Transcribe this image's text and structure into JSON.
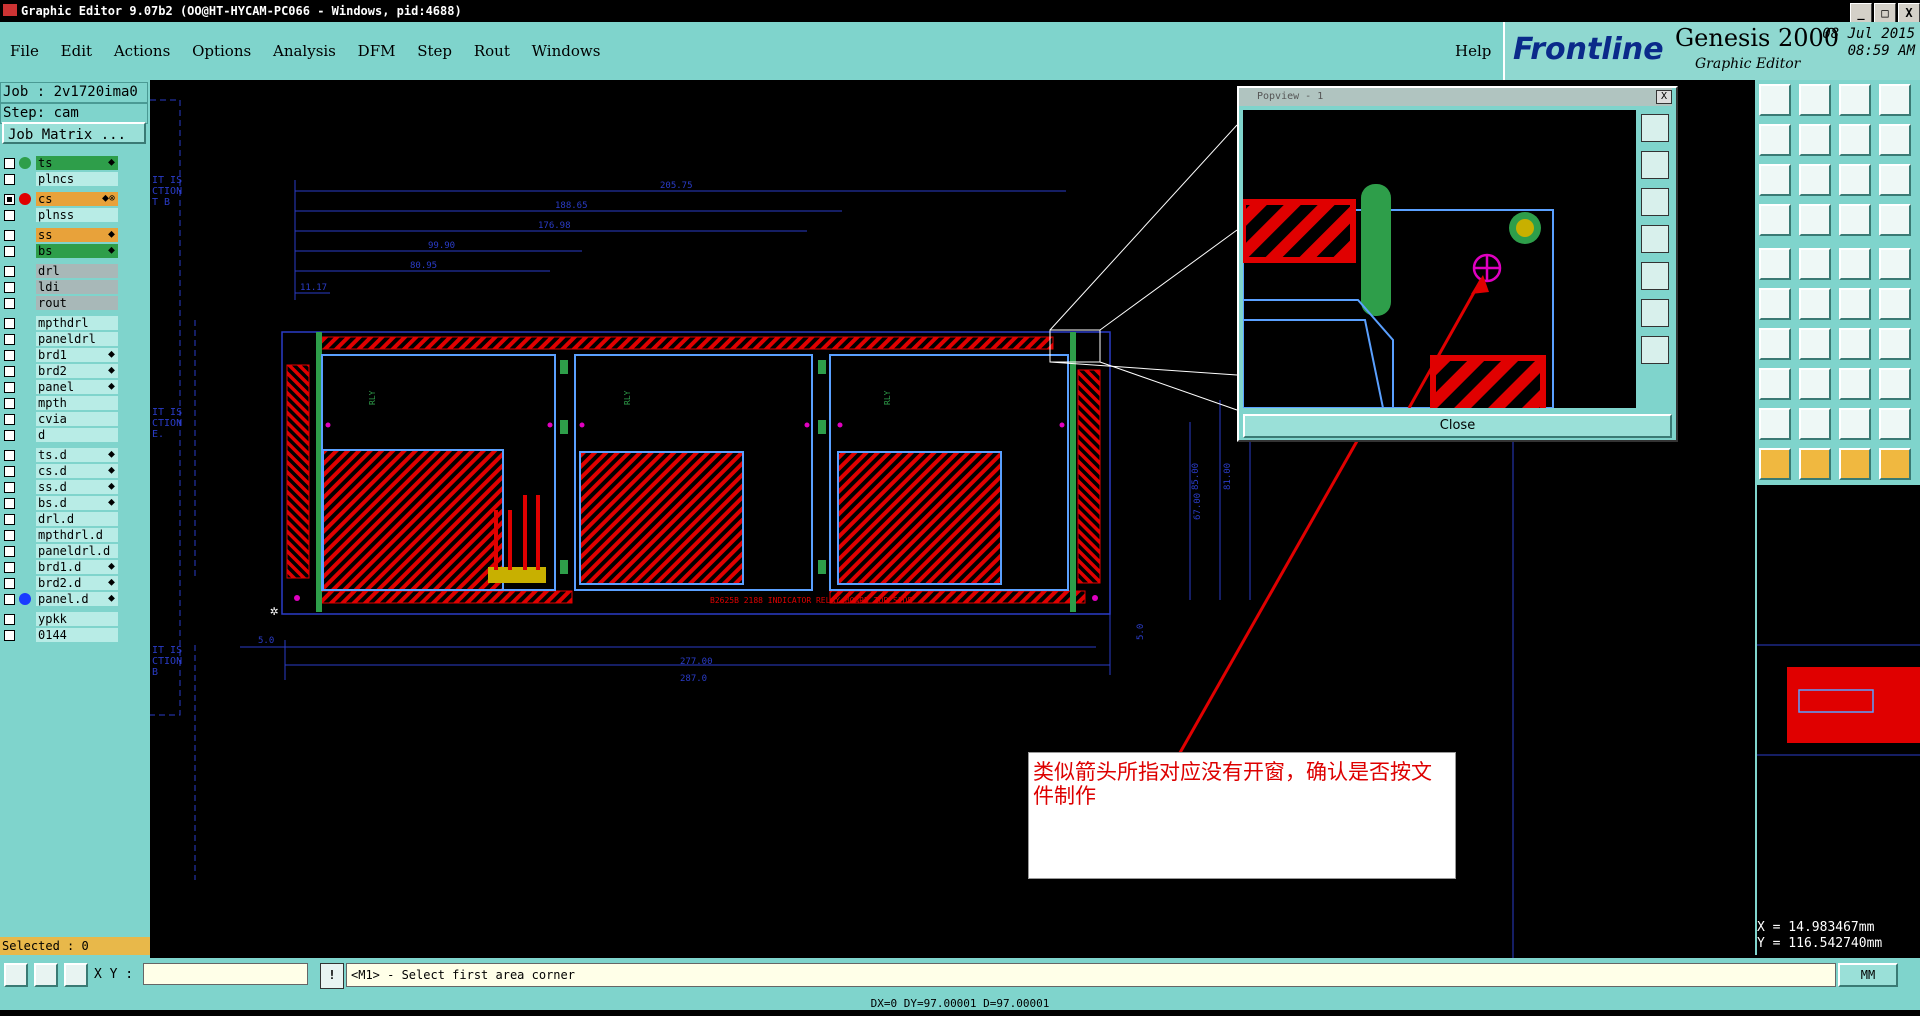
{
  "window": {
    "title": "Graphic Editor 9.07b2 (OO@HT-HYCAM-PC066 - Windows, pid:4688)",
    "controls": [
      "_",
      "□",
      "X"
    ]
  },
  "menu": {
    "items": [
      "File",
      "Edit",
      "Actions",
      "Options",
      "Analysis",
      "DFM",
      "Step",
      "Rout",
      "Windows"
    ],
    "help": "Help"
  },
  "brand": {
    "logo": "Frontline",
    "product": "Genesis 2000",
    "subtitle": "Graphic Editor",
    "date": "08 Jul 2015",
    "time": "08:59 AM"
  },
  "job": {
    "job_label": "Job : 2v1720ima0",
    "step_label": "Step: cam",
    "matrix_button": "Job Matrix ..."
  },
  "layers": [
    {
      "name": "ts",
      "style": "g",
      "dot": "#2e9e4a",
      "mark": "⬥"
    },
    {
      "name": "plncs",
      "style": "",
      "dot": "",
      "mark": ""
    },
    {
      "name": "cs",
      "style": "o",
      "dot": "#e00000",
      "mark": "⬥⊗",
      "checked": true
    },
    {
      "name": "plnss",
      "style": "",
      "dot": "",
      "mark": ""
    },
    {
      "name": "ss",
      "style": "o",
      "dot": "",
      "mark": "⬥"
    },
    {
      "name": "bs",
      "style": "g",
      "dot": "",
      "mark": "⬥"
    },
    {
      "name": "drl",
      "style": "gr",
      "dot": "",
      "mark": ""
    },
    {
      "name": "ldi",
      "style": "gr",
      "dot": "",
      "mark": ""
    },
    {
      "name": "rout",
      "style": "gr",
      "dot": "",
      "mark": ""
    },
    {
      "name": "mpthdrl",
      "style": "",
      "dot": "",
      "mark": ""
    },
    {
      "name": "paneldrl",
      "style": "",
      "dot": "",
      "mark": ""
    },
    {
      "name": "brd1",
      "style": "",
      "dot": "",
      "mark": "⬥"
    },
    {
      "name": "brd2",
      "style": "",
      "dot": "",
      "mark": "⬥"
    },
    {
      "name": "panel",
      "style": "",
      "dot": "",
      "mark": "⬥"
    },
    {
      "name": "mpth",
      "style": "",
      "dot": "",
      "mark": ""
    },
    {
      "name": "cvia",
      "style": "",
      "dot": "",
      "mark": ""
    },
    {
      "name": "d",
      "style": "",
      "dot": "",
      "mark": ""
    },
    {
      "name": "ts.d",
      "style": "",
      "dot": "",
      "mark": "⬥"
    },
    {
      "name": "cs.d",
      "style": "",
      "dot": "",
      "mark": "⬥"
    },
    {
      "name": "ss.d",
      "style": "",
      "dot": "",
      "mark": "⬥"
    },
    {
      "name": "bs.d",
      "style": "",
      "dot": "",
      "mark": "⬥"
    },
    {
      "name": "drl.d",
      "style": "",
      "dot": "",
      "mark": ""
    },
    {
      "name": "mpthdrl.d",
      "style": "",
      "dot": "",
      "mark": ""
    },
    {
      "name": "paneldrl.d",
      "style": "",
      "dot": "",
      "mark": ""
    },
    {
      "name": "brd1.d",
      "style": "",
      "dot": "",
      "mark": "⬥"
    },
    {
      "name": "brd2.d",
      "style": "",
      "dot": "",
      "mark": "⬥"
    },
    {
      "name": "panel.d",
      "style": "",
      "dot": "#1a3cff",
      "mark": "⬥"
    },
    {
      "name": "ypkk",
      "style": "",
      "dot": "",
      "mark": ""
    },
    {
      "name": "0144",
      "style": "",
      "dot": "",
      "mark": ""
    }
  ],
  "selected": "Selected : 0",
  "canvas": {
    "dims": [
      "205.75",
      "188.65",
      "176.98",
      "99.90",
      "80.95",
      "11.17",
      "277.00",
      "287.0",
      "5.0",
      "5.0",
      "67.00",
      "85.00",
      "81.00"
    ],
    "board_label": "B2625B  2188 INDICATOR RELAY BOARD  TOP SIDE",
    "side_text": [
      "IT IS",
      "CTION",
      "T B"
    ],
    "side_text2": [
      "IT IS",
      "CTION",
      "E."
    ],
    "side_text3": [
      "IT IS",
      "CTION",
      "B"
    ]
  },
  "popview": {
    "title": "Popview - 1",
    "close_x": "X",
    "close_button": "Close"
  },
  "annotation": {
    "text": "类似箭头所指对应没有开窗，确认是否按文件制作"
  },
  "coords": {
    "x": "X = 14.983467mm",
    "y": "Y = 116.542740mm"
  },
  "bottom": {
    "xy_label": "X Y :",
    "xy_value": "",
    "prompt_btn": "!",
    "prompt": "<M1> - Select first area corner",
    "units": "MM"
  },
  "status": "DX=0 DY=97.00001 D=97.00001",
  "colors": {
    "teal": "#7fd4cc",
    "red": "#e00000",
    "green": "#2e9e4a",
    "blue": "#3a5cff",
    "highlight": "#f0b840"
  }
}
